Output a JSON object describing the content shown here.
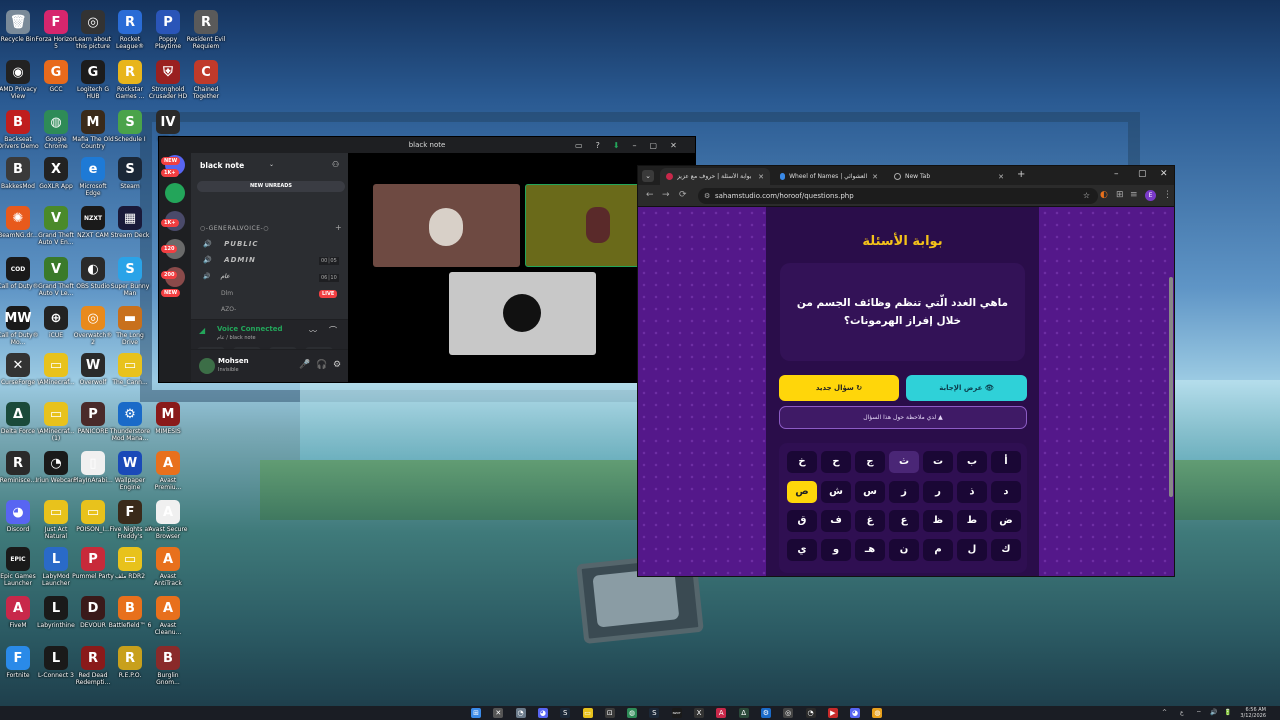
{
  "desktop": {
    "icons": [
      {
        "label": "Recycle Bin",
        "glyph": "🗑",
        "color": "#7a8a99",
        "col": 0,
        "row": 0
      },
      {
        "label": "Forza Horizon 5",
        "glyph": "F",
        "color": "#d6266d",
        "col": 1,
        "row": 0
      },
      {
        "label": "Learn about this picture",
        "glyph": "◎",
        "color": "#333333",
        "col": 2,
        "row": 0
      },
      {
        "label": "Rocket League®",
        "glyph": "R",
        "color": "#2a6cd6",
        "col": 3,
        "row": 0
      },
      {
        "label": "Poppy Playtime",
        "glyph": "P",
        "color": "#2a55b8",
        "col": 4,
        "row": 0
      },
      {
        "label": "Resident Evil Requiem",
        "glyph": "R",
        "color": "#5a5a5a",
        "col": 5,
        "row": 0
      },
      {
        "label": "AMD Privacy View",
        "glyph": "◉",
        "color": "#222222",
        "col": 0,
        "row": 1
      },
      {
        "label": "GCC",
        "glyph": "G",
        "color": "#e86a1c",
        "col": 1,
        "row": 1
      },
      {
        "label": "Logitech G HUB",
        "glyph": "G",
        "color": "#1c1c1c",
        "col": 2,
        "row": 1
      },
      {
        "label": "Rockstar Games ...",
        "glyph": "R",
        "color": "#e8b51c",
        "col": 3,
        "row": 1
      },
      {
        "label": "Stronghold Crusader HD",
        "glyph": "⛨",
        "color": "#9a2020",
        "col": 4,
        "row": 1
      },
      {
        "label": "Chained Together",
        "glyph": "C",
        "color": "#c03a2a",
        "col": 5,
        "row": 1
      },
      {
        "label": "Backseat Drivers Demo",
        "glyph": "B",
        "color": "#c01e1e",
        "col": 0,
        "row": 2
      },
      {
        "label": "Google Chrome",
        "glyph": "◍",
        "color": "#2e8b57",
        "col": 1,
        "row": 2
      },
      {
        "label": "Mafia The Old Country",
        "glyph": "M",
        "color": "#3a2a1a",
        "col": 2,
        "row": 2
      },
      {
        "label": "Schedule I",
        "glyph": "S",
        "color": "#4aa34a",
        "col": 3,
        "row": 2
      },
      {
        "label": "GTA IV",
        "glyph": "IV",
        "color": "#2a2a2a",
        "col": 4,
        "row": 2
      },
      {
        "label": "BakkesMod",
        "glyph": "B",
        "color": "#3a3a3a",
        "col": 0,
        "row": 3
      },
      {
        "label": "GoXLR App",
        "glyph": "X",
        "color": "#222222",
        "col": 1,
        "row": 3
      },
      {
        "label": "Microsoft Edge",
        "glyph": "e",
        "color": "#1e7ad6",
        "col": 2,
        "row": 3
      },
      {
        "label": "Steam",
        "glyph": "S",
        "color": "#1b2838",
        "col": 3,
        "row": 3
      },
      {
        "label": "BeamNG.dr...",
        "glyph": "✺",
        "color": "#e85a1c",
        "col": 0,
        "row": 4
      },
      {
        "label": "Grand Theft Auto V En...",
        "glyph": "V",
        "color": "#4a8a2a",
        "col": 1,
        "row": 4
      },
      {
        "label": "NZXT CAM",
        "glyph": "NZXT",
        "color": "#1a1a1a",
        "col": 2,
        "row": 4
      },
      {
        "label": "Stream Deck",
        "glyph": "▦",
        "color": "#1a1a3a",
        "col": 3,
        "row": 4
      },
      {
        "label": "Call of Duty®",
        "glyph": "COD",
        "color": "#1a1a1a",
        "col": 0,
        "row": 5
      },
      {
        "label": "Grand Theft Auto V Le...",
        "glyph": "V",
        "color": "#3a7a2a",
        "col": 1,
        "row": 5
      },
      {
        "label": "OBS Studio",
        "glyph": "◐",
        "color": "#2a2a2a",
        "col": 2,
        "row": 5
      },
      {
        "label": "Super Bunny Man",
        "glyph": "S",
        "color": "#2aa3e8",
        "col": 3,
        "row": 5
      },
      {
        "label": "Call of Duty® Mo...",
        "glyph": "MW",
        "color": "#1a1a1a",
        "col": 0,
        "row": 6
      },
      {
        "label": "iCUE",
        "glyph": "⊕",
        "color": "#222222",
        "col": 1,
        "row": 6
      },
      {
        "label": "Overwatch® 2",
        "glyph": "◎",
        "color": "#e88a1c",
        "col": 2,
        "row": 6
      },
      {
        "label": "The Long Drive",
        "glyph": "▬",
        "color": "#c8701c",
        "col": 3,
        "row": 6
      },
      {
        "label": "CurseForge",
        "glyph": "✕",
        "color": "#333333",
        "col": 0,
        "row": 7
      },
      {
        "label": "\\AMinecraf...",
        "glyph": "▭",
        "color": "#e8c21c",
        "col": 1,
        "row": 7
      },
      {
        "label": "Overwolf",
        "glyph": "W",
        "color": "#2a2a2a",
        "col": 2,
        "row": 7
      },
      {
        "label": "The_Cann...",
        "glyph": "▭",
        "color": "#e8c21c",
        "col": 3,
        "row": 7
      },
      {
        "label": "Delta Force",
        "glyph": "Δ",
        "color": "#1a4a3a",
        "col": 0,
        "row": 8
      },
      {
        "label": "\\AMinecraf... (1)",
        "glyph": "▭",
        "color": "#e8c21c",
        "col": 1,
        "row": 8
      },
      {
        "label": "PANICORE",
        "glyph": "P",
        "color": "#4a2a2a",
        "col": 2,
        "row": 8
      },
      {
        "label": "Thunderstore Mod Mana...",
        "glyph": "⚙",
        "color": "#1a6ac8",
        "col": 3,
        "row": 8
      },
      {
        "label": "MIMESIS",
        "glyph": "M",
        "color": "#8a1a1a",
        "col": 4,
        "row": 8
      },
      {
        "label": "Reminisce...",
        "glyph": "R",
        "color": "#2a2a2a",
        "col": 0,
        "row": 9
      },
      {
        "label": "Iriun Webcam",
        "glyph": "◔",
        "color": "#1a1a1a",
        "col": 1,
        "row": 9
      },
      {
        "label": "PlayInArabi...",
        "glyph": "▯",
        "color": "#f0f0f0",
        "col": 2,
        "row": 9
      },
      {
        "label": "Wallpaper Engine",
        "glyph": "W",
        "color": "#1a4ab8",
        "col": 3,
        "row": 9
      },
      {
        "label": "Avast Premiu...",
        "glyph": "A",
        "color": "#e8701c",
        "col": 4,
        "row": 9
      },
      {
        "label": "Discord",
        "glyph": "◕",
        "color": "#5865f2",
        "col": 0,
        "row": 10
      },
      {
        "label": "Just Act Natural",
        "glyph": "▭",
        "color": "#e8c21c",
        "col": 1,
        "row": 10
      },
      {
        "label": "POISON_I...",
        "glyph": "▭",
        "color": "#e8c21c",
        "col": 2,
        "row": 10
      },
      {
        "label": "Five Nights at Freddy's",
        "glyph": "F",
        "color": "#3a2a1a",
        "col": 3,
        "row": 10
      },
      {
        "label": "Avast Secure Browser",
        "glyph": "A",
        "color": "#f0f0f0",
        "col": 4,
        "row": 10
      },
      {
        "label": "Epic Games Launcher",
        "glyph": "EPIC",
        "color": "#1a1a1a",
        "col": 0,
        "row": 11
      },
      {
        "label": "LabyMod Launcher",
        "glyph": "L",
        "color": "#2a6ac8",
        "col": 1,
        "row": 11
      },
      {
        "label": "Pummel Party",
        "glyph": "P",
        "color": "#c82a3a",
        "col": 2,
        "row": 11
      },
      {
        "label": "ملف RDR2",
        "glyph": "▭",
        "color": "#e8c21c",
        "col": 3,
        "row": 11
      },
      {
        "label": "Avast AntiTrack",
        "glyph": "A",
        "color": "#e8701c",
        "col": 4,
        "row": 11
      },
      {
        "label": "FiveM",
        "glyph": "A",
        "color": "#c8284a",
        "col": 0,
        "row": 12
      },
      {
        "label": "Labyrinthine",
        "glyph": "L",
        "color": "#1a1a1a",
        "col": 1,
        "row": 12
      },
      {
        "label": "DEVOUR",
        "glyph": "D",
        "color": "#3a1a1a",
        "col": 2,
        "row": 12
      },
      {
        "label": "Battlefield™ 6",
        "glyph": "B",
        "color": "#e8701c",
        "col": 3,
        "row": 12
      },
      {
        "label": "Avast Cleanu...",
        "glyph": "A",
        "color": "#e8701c",
        "col": 4,
        "row": 12
      },
      {
        "label": "Fortnite",
        "glyph": "F",
        "color": "#2a8ae8",
        "col": 0,
        "row": 13
      },
      {
        "label": "L-Connect 3",
        "glyph": "L",
        "color": "#1a1a1a",
        "col": 1,
        "row": 13
      },
      {
        "label": "Red Dead Redempti...",
        "glyph": "R",
        "color": "#8a1a1a",
        "col": 2,
        "row": 13
      },
      {
        "label": "R.E.P.O.",
        "glyph": "R",
        "color": "#c8a01c",
        "col": 3,
        "row": 13
      },
      {
        "label": "Burglin Gnom...",
        "glyph": "B",
        "color": "#8a2a2a",
        "col": 4,
        "row": 13
      }
    ]
  },
  "discord": {
    "window_title": "black note",
    "window_controls": [
      "▭",
      "?",
      "⬇",
      "–",
      "▢",
      "✕"
    ],
    "server_name": "black note",
    "new_unreads": "NEW UNREADS",
    "server_badges": [
      "NEW",
      "1K+",
      "1K+",
      "120",
      "200",
      "NEW"
    ],
    "category": "○-GENERALVOICE-○",
    "channels": [
      {
        "name": "PUBLIC",
        "icon": "🔊"
      },
      {
        "name": "ADMIN",
        "icon": "🔊"
      },
      {
        "name": "عام",
        "icon": "🔊"
      }
    ],
    "counters": [
      [
        "00",
        "05"
      ],
      [
        "06",
        "10"
      ]
    ],
    "users": [
      "Dlm",
      "AZO-"
    ],
    "live_label": "LIVE",
    "voice": {
      "title": "Voice Connected",
      "subtitle": "عام / black note"
    },
    "voice_buttons": [
      "🎥",
      "🖥",
      "✦",
      "♫"
    ],
    "me": {
      "name": "Mohsen",
      "status": "Invisible"
    },
    "me_controls": [
      "🎤",
      "🎧",
      "⚙"
    ],
    "tile_colors": [
      "#6e4a42",
      "#6a6a1a",
      "#c8c8c8"
    ],
    "accent": "#23a55a"
  },
  "browser": {
    "tabs": [
      {
        "title": "بوابة الأسئلة | حروف مع عزيز",
        "active": true
      },
      {
        "title": "Wheel of Names | عجلة الاسم العشوائي",
        "active": false
      },
      {
        "title": "New Tab",
        "active": false
      }
    ],
    "new_tab_button": "+",
    "window_controls": [
      "–",
      "▢",
      "✕"
    ],
    "url": "sahamstudio.com/horoof/questions.php",
    "nav": [
      "←",
      "→",
      "⟳",
      "⚙"
    ],
    "toolbar_icons": [
      "☆",
      "◐",
      "⊞",
      "≡",
      "E",
      "⋮"
    ],
    "page": {
      "title": "بوابة الأسئلة",
      "question": "ماهي الغدد الّتي تنظم وظائف الجسم من خلال إفراز الهرمونات؟",
      "new_question": "سؤال جديد ↻",
      "show_answer": "عرض الإجابة 👁",
      "note": "لدي ملاحظة حول هذا السؤال ▲",
      "keys_row1": [
        "خ",
        "ح",
        "ج",
        "ث",
        "ت",
        "ب",
        "أ"
      ],
      "keys_row2": [
        "ص",
        "ش",
        "س",
        "ز",
        "ر",
        "ذ",
        "د"
      ],
      "keys_row3": [
        "ق",
        "ف",
        "غ",
        "ع",
        "ظ",
        "ط",
        "ض"
      ],
      "keys_row4": [
        "ي",
        "و",
        "هـ",
        "ن",
        "م",
        "ل",
        "ك"
      ],
      "highlighted_key": "ص",
      "hovered_key": "ث",
      "colors": {
        "gold": "#ffd60a",
        "cyan": "#2fd1d8",
        "purple": "#5a1f8f"
      }
    }
  },
  "taskbar": {
    "icons": [
      {
        "glyph": "⊞",
        "color": "#3a8ae8"
      },
      {
        "glyph": "✕",
        "color": "#555555"
      },
      {
        "glyph": "◔",
        "color": "#6a7a8a"
      },
      {
        "glyph": "◕",
        "color": "#5865f2"
      },
      {
        "glyph": "S",
        "color": "#1b2838"
      },
      {
        "glyph": "▭",
        "color": "#e8c21c"
      },
      {
        "glyph": "⊡",
        "color": "#3a3a3a"
      },
      {
        "glyph": "◍",
        "color": "#2e8b57"
      },
      {
        "glyph": "S",
        "color": "#1b2838"
      },
      {
        "glyph": "NZXT",
        "color": "#1a1a1a"
      },
      {
        "glyph": "X",
        "color": "#333333"
      },
      {
        "glyph": "A",
        "color": "#c8284a"
      },
      {
        "glyph": "Δ",
        "color": "#2a4a3a"
      },
      {
        "glyph": "⚙",
        "color": "#1a6ac8"
      },
      {
        "glyph": "◎",
        "color": "#444444"
      },
      {
        "glyph": "◔",
        "color": "#2a2a2a"
      },
      {
        "glyph": "▶",
        "color": "#c82a2a"
      },
      {
        "glyph": "◕",
        "color": "#5865f2"
      },
      {
        "glyph": "◍",
        "color": "#e8a01c"
      }
    ],
    "tray": [
      "^",
      "ع",
      "⌔",
      "🔊",
      "🔋"
    ],
    "time": "6:56 AM",
    "date": "3/12/2026"
  }
}
